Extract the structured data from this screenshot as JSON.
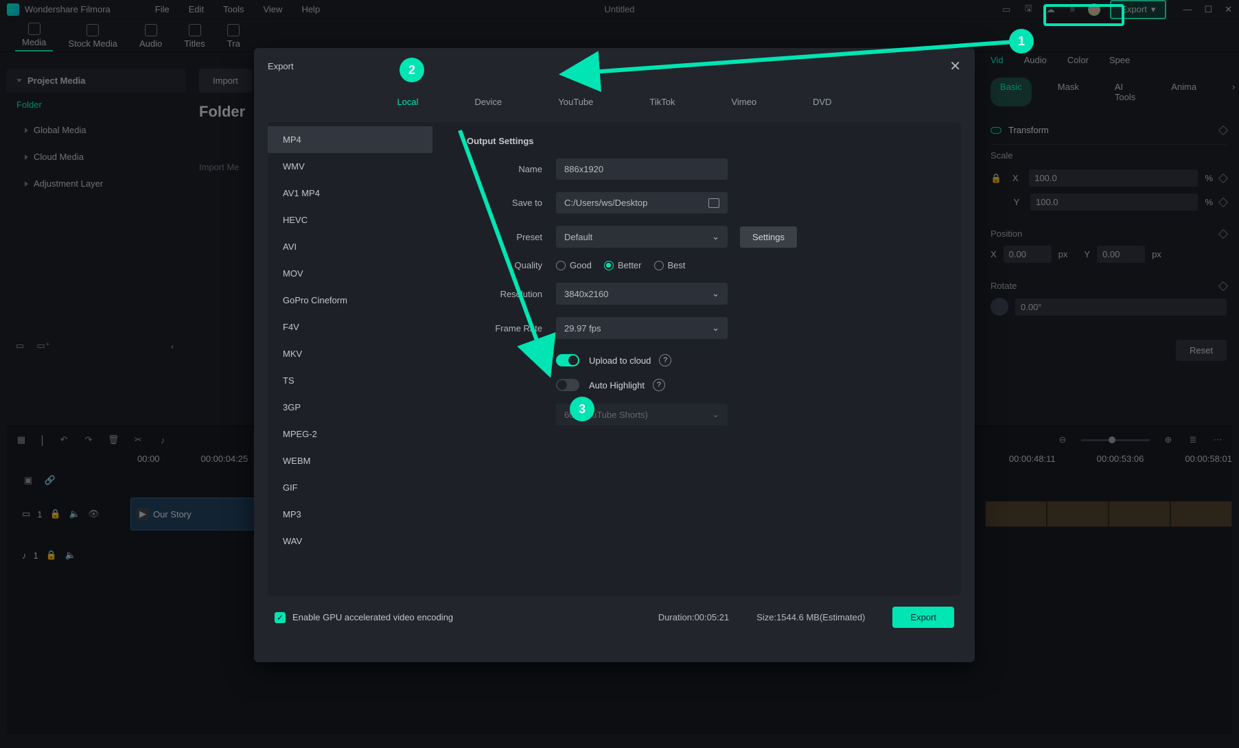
{
  "app": {
    "title": "Wondershare Filmora",
    "document": "Untitled"
  },
  "menus": [
    "File",
    "Edit",
    "Tools",
    "View",
    "Help"
  ],
  "export_button": "Export",
  "top_tabs": [
    "Media",
    "Stock Media",
    "Audio",
    "Titles",
    "Tra"
  ],
  "left": {
    "project_media": "Project Media",
    "folder": "Folder",
    "items": [
      "Global Media",
      "Cloud Media",
      "Adjustment Layer"
    ]
  },
  "midpanel": {
    "import": "Import",
    "folder": "Folder",
    "import_media": "Import Me"
  },
  "props": {
    "tabs": [
      "Vid",
      "Audio",
      "Color",
      "Spee"
    ],
    "subtabs": [
      "Basic",
      "Mask",
      "AI Tools",
      "Anima"
    ],
    "transform": "Transform",
    "scale": "Scale",
    "x_label": "X",
    "y_label": "Y",
    "x_val": "100.0",
    "y_val": "100.0",
    "pct": "%",
    "position": "Position",
    "px_x": "0.00",
    "px_y": "0.00",
    "px": "px",
    "rotate": "Rotate",
    "rotate_val": "0.00°",
    "reset": "Reset"
  },
  "timeline": {
    "marks": [
      "00:00",
      "00:00:04:25"
    ],
    "marks_right": [
      "00:00:48:11",
      "00:00:53:06",
      "00:00:58:01"
    ],
    "track_video": "1",
    "track_audio": "1",
    "clip_title": "Our Story"
  },
  "modal": {
    "title": "Export",
    "tabs": [
      "Local",
      "Device",
      "YouTube",
      "TikTok",
      "Vimeo",
      "DVD"
    ],
    "formats": [
      "MP4",
      "WMV",
      "AV1 MP4",
      "HEVC",
      "AVI",
      "MOV",
      "GoPro Cineform",
      "F4V",
      "MKV",
      "TS",
      "3GP",
      "MPEG-2",
      "WEBM",
      "GIF",
      "MP3",
      "WAV"
    ],
    "output_settings": "Output Settings",
    "name_label": "Name",
    "name_value": "886x1920",
    "save_label": "Save to",
    "save_value": "C:/Users/ws/Desktop",
    "preset_label": "Preset",
    "preset_value": "Default",
    "settings_btn": "Settings",
    "quality_label": "Quality",
    "quality_opts": [
      "Good",
      "Better",
      "Best"
    ],
    "resolution_label": "Resolution",
    "resolution_value": "3840x2160",
    "fps_label": "Frame Rate",
    "fps_value": "29.97 fps",
    "upload_label": "Upload to cloud",
    "autohl_label": "Auto Highlight",
    "shorts_value": "60s(YouTube Shorts)",
    "gpu_label": "Enable GPU accelerated video encoding",
    "duration_label": "Duration:",
    "duration_value": "00:05:21",
    "size_label": "Size:",
    "size_value": "1544.6 MB(Estimated)",
    "export": "Export"
  },
  "annotations": {
    "b1": "1",
    "b2": "2",
    "b3": "3"
  }
}
